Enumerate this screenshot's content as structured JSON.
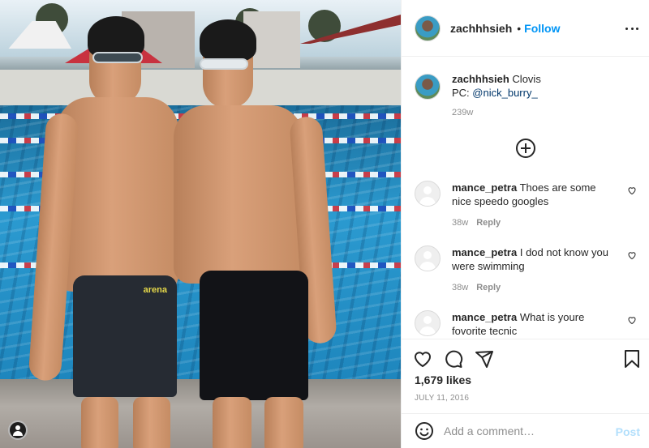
{
  "post": {
    "username": "zachhhsieh",
    "separator": "•",
    "follow_label": "Follow",
    "caption_location": "Clovis",
    "caption_line2_prefix": "PC: ",
    "caption_mention": "@nick_burry_",
    "caption_time": "239w",
    "likes": "1,679 likes",
    "date": "JULY 11, 2016"
  },
  "comments": [
    {
      "username": "mance_petra",
      "text": "Thoes are some nice speedo googles",
      "time": "38w",
      "reply_label": "Reply"
    },
    {
      "username": "mance_petra",
      "text": "I dod not know you were swimming",
      "time": "38w",
      "reply_label": "Reply"
    },
    {
      "username": "mance_petra",
      "text": "What is youre fovorite tecnic",
      "time": "",
      "reply_label": ""
    }
  ],
  "add_comment": {
    "placeholder": "Add a comment…",
    "post_label": "Post"
  },
  "photo": {
    "suit_brand": "arena"
  },
  "icons": {
    "more": "more-options-icon",
    "load_more": "plus-circle-icon",
    "like": "heart-icon",
    "comment": "comment-icon",
    "share": "share-icon",
    "save": "bookmark-icon",
    "emoji": "emoji-icon"
  },
  "colors": {
    "link": "#0095f6",
    "post_disabled": "#b2dffc",
    "muted": "#8e8e8e"
  }
}
